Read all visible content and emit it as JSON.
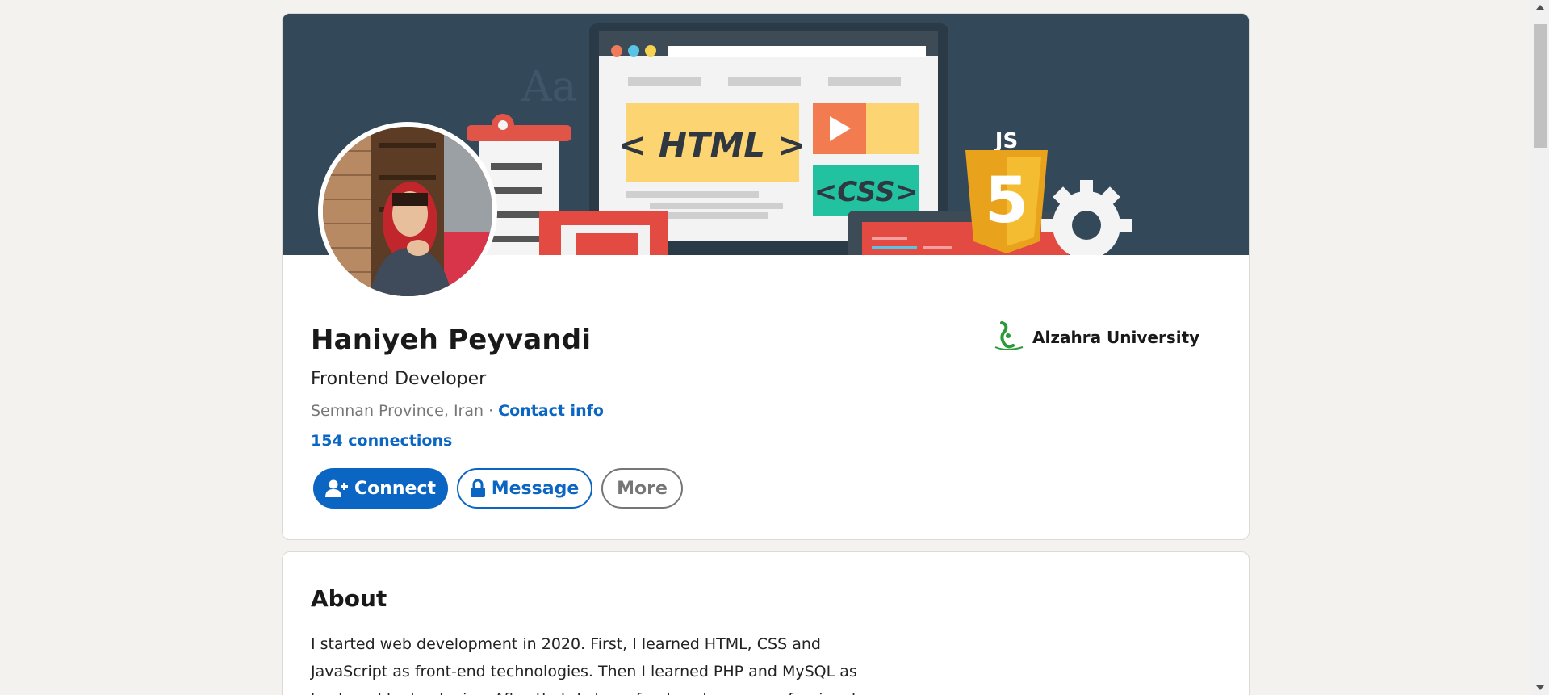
{
  "profile": {
    "name": "Haniyeh Peyvandi",
    "headline": "Frontend Developer",
    "location": "Semnan Province, Iran",
    "separator": " · ",
    "contact_info": "Contact info",
    "connections": "154 connections",
    "education": "Alzahra University",
    "banner_text": {
      "html": "< HTML >",
      "css": "<CSS>",
      "js": "JS",
      "five": "5",
      "font_sample": "Aa"
    }
  },
  "actions": {
    "connect": "Connect",
    "message": "Message",
    "more": "More"
  },
  "about": {
    "title": "About",
    "text": "I started web development in 2020. First, I learned HTML, CSS and JavaScript as front-end technologies. Then I learned PHP and MySQL as back-end technologies. After that, I chose front-end as my professional"
  },
  "colors": {
    "accent": "#0a66c2",
    "banner": "#33495a",
    "page_bg": "#f3f2ef"
  },
  "icons": {
    "connect": "add-person-icon",
    "message": "lock-icon",
    "education": "university-logo"
  }
}
